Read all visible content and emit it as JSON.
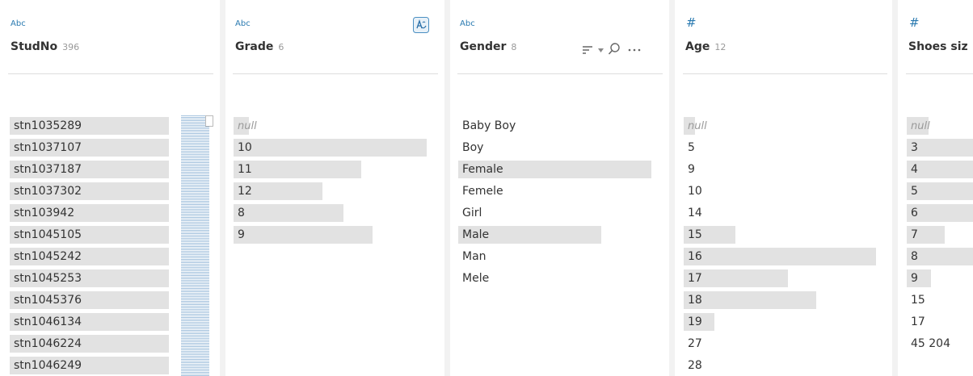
{
  "columns": {
    "studno": {
      "type_label": "Abc",
      "name": "StudNo",
      "count": "396",
      "rows": [
        "stn1035289",
        "stn1037107",
        "stn1037187",
        "stn1037302",
        "stn103942",
        "stn1045105",
        "stn1045242",
        "stn1045253",
        "stn1045376",
        "stn1046134",
        "stn1046224",
        "stn1046249"
      ]
    },
    "grade": {
      "type_label": "Abc",
      "name": "Grade",
      "count": "6",
      "rows": [
        {
          "label": "null",
          "value": 8
        },
        {
          "label": "10",
          "value": 100
        },
        {
          "label": "11",
          "value": 66
        },
        {
          "label": "12",
          "value": 46
        },
        {
          "label": "8",
          "value": 57
        },
        {
          "label": "9",
          "value": 72
        }
      ]
    },
    "gender": {
      "type_label": "Abc",
      "name": "Gender",
      "count": "8",
      "rows": [
        {
          "label": "Baby Boy",
          "value": 0
        },
        {
          "label": "Boy",
          "value": 0
        },
        {
          "label": "Female",
          "value": 100
        },
        {
          "label": "Femele",
          "value": 0
        },
        {
          "label": "Girl",
          "value": 0
        },
        {
          "label": "Male",
          "value": 74
        },
        {
          "label": "Man",
          "value": 0
        },
        {
          "label": "Mele",
          "value": 0
        }
      ]
    },
    "age": {
      "type_label": "#",
      "name": "Age",
      "count": "12",
      "rows": [
        {
          "label": "null",
          "value": 6
        },
        {
          "label": "5",
          "value": 0
        },
        {
          "label": "9",
          "value": 0
        },
        {
          "label": "10",
          "value": 0
        },
        {
          "label": "14",
          "value": 0
        },
        {
          "label": "15",
          "value": 27
        },
        {
          "label": "16",
          "value": 100
        },
        {
          "label": "17",
          "value": 54
        },
        {
          "label": "18",
          "value": 69
        },
        {
          "label": "19",
          "value": 16
        },
        {
          "label": "27",
          "value": 0
        },
        {
          "label": "28",
          "value": 0
        }
      ]
    },
    "shoes": {
      "type_label": "#",
      "name": "Shoes siz",
      "rows": [
        {
          "label": "null",
          "value": 33
        },
        {
          "label": "3",
          "value": 100
        },
        {
          "label": "4",
          "value": 100
        },
        {
          "label": "5",
          "value": 100
        },
        {
          "label": "6",
          "value": 100
        },
        {
          "label": "7",
          "value": 57
        },
        {
          "label": "8",
          "value": 100
        },
        {
          "label": "9",
          "value": 37
        },
        {
          "label": "15",
          "value": 0
        },
        {
          "label": "17",
          "value": 0
        },
        {
          "label": "45 204",
          "value": 0
        }
      ]
    }
  }
}
